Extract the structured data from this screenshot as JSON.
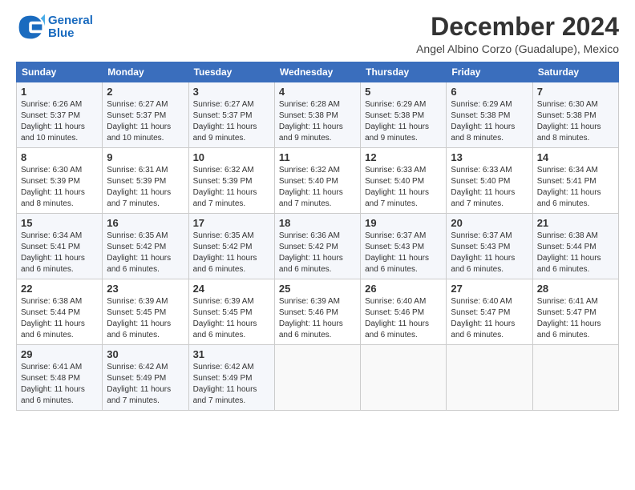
{
  "logo": {
    "line1": "General",
    "line2": "Blue"
  },
  "title": "December 2024",
  "subtitle": "Angel Albino Corzo (Guadalupe), Mexico",
  "days_of_week": [
    "Sunday",
    "Monday",
    "Tuesday",
    "Wednesday",
    "Thursday",
    "Friday",
    "Saturday"
  ],
  "weeks": [
    [
      {
        "day": 1,
        "sunrise": "6:26 AM",
        "sunset": "5:37 PM",
        "daylight": "11 hours and 10 minutes."
      },
      {
        "day": 2,
        "sunrise": "6:27 AM",
        "sunset": "5:37 PM",
        "daylight": "11 hours and 10 minutes."
      },
      {
        "day": 3,
        "sunrise": "6:27 AM",
        "sunset": "5:37 PM",
        "daylight": "11 hours and 9 minutes."
      },
      {
        "day": 4,
        "sunrise": "6:28 AM",
        "sunset": "5:38 PM",
        "daylight": "11 hours and 9 minutes."
      },
      {
        "day": 5,
        "sunrise": "6:29 AM",
        "sunset": "5:38 PM",
        "daylight": "11 hours and 9 minutes."
      },
      {
        "day": 6,
        "sunrise": "6:29 AM",
        "sunset": "5:38 PM",
        "daylight": "11 hours and 8 minutes."
      },
      {
        "day": 7,
        "sunrise": "6:30 AM",
        "sunset": "5:38 PM",
        "daylight": "11 hours and 8 minutes."
      }
    ],
    [
      {
        "day": 8,
        "sunrise": "6:30 AM",
        "sunset": "5:39 PM",
        "daylight": "11 hours and 8 minutes."
      },
      {
        "day": 9,
        "sunrise": "6:31 AM",
        "sunset": "5:39 PM",
        "daylight": "11 hours and 7 minutes."
      },
      {
        "day": 10,
        "sunrise": "6:32 AM",
        "sunset": "5:39 PM",
        "daylight": "11 hours and 7 minutes."
      },
      {
        "day": 11,
        "sunrise": "6:32 AM",
        "sunset": "5:40 PM",
        "daylight": "11 hours and 7 minutes."
      },
      {
        "day": 12,
        "sunrise": "6:33 AM",
        "sunset": "5:40 PM",
        "daylight": "11 hours and 7 minutes."
      },
      {
        "day": 13,
        "sunrise": "6:33 AM",
        "sunset": "5:40 PM",
        "daylight": "11 hours and 7 minutes."
      },
      {
        "day": 14,
        "sunrise": "6:34 AM",
        "sunset": "5:41 PM",
        "daylight": "11 hours and 6 minutes."
      }
    ],
    [
      {
        "day": 15,
        "sunrise": "6:34 AM",
        "sunset": "5:41 PM",
        "daylight": "11 hours and 6 minutes."
      },
      {
        "day": 16,
        "sunrise": "6:35 AM",
        "sunset": "5:42 PM",
        "daylight": "11 hours and 6 minutes."
      },
      {
        "day": 17,
        "sunrise": "6:35 AM",
        "sunset": "5:42 PM",
        "daylight": "11 hours and 6 minutes."
      },
      {
        "day": 18,
        "sunrise": "6:36 AM",
        "sunset": "5:42 PM",
        "daylight": "11 hours and 6 minutes."
      },
      {
        "day": 19,
        "sunrise": "6:37 AM",
        "sunset": "5:43 PM",
        "daylight": "11 hours and 6 minutes."
      },
      {
        "day": 20,
        "sunrise": "6:37 AM",
        "sunset": "5:43 PM",
        "daylight": "11 hours and 6 minutes."
      },
      {
        "day": 21,
        "sunrise": "6:38 AM",
        "sunset": "5:44 PM",
        "daylight": "11 hours and 6 minutes."
      }
    ],
    [
      {
        "day": 22,
        "sunrise": "6:38 AM",
        "sunset": "5:44 PM",
        "daylight": "11 hours and 6 minutes."
      },
      {
        "day": 23,
        "sunrise": "6:39 AM",
        "sunset": "5:45 PM",
        "daylight": "11 hours and 6 minutes."
      },
      {
        "day": 24,
        "sunrise": "6:39 AM",
        "sunset": "5:45 PM",
        "daylight": "11 hours and 6 minutes."
      },
      {
        "day": 25,
        "sunrise": "6:39 AM",
        "sunset": "5:46 PM",
        "daylight": "11 hours and 6 minutes."
      },
      {
        "day": 26,
        "sunrise": "6:40 AM",
        "sunset": "5:46 PM",
        "daylight": "11 hours and 6 minutes."
      },
      {
        "day": 27,
        "sunrise": "6:40 AM",
        "sunset": "5:47 PM",
        "daylight": "11 hours and 6 minutes."
      },
      {
        "day": 28,
        "sunrise": "6:41 AM",
        "sunset": "5:47 PM",
        "daylight": "11 hours and 6 minutes."
      }
    ],
    [
      {
        "day": 29,
        "sunrise": "6:41 AM",
        "sunset": "5:48 PM",
        "daylight": "11 hours and 6 minutes."
      },
      {
        "day": 30,
        "sunrise": "6:42 AM",
        "sunset": "5:49 PM",
        "daylight": "11 hours and 7 minutes."
      },
      {
        "day": 31,
        "sunrise": "6:42 AM",
        "sunset": "5:49 PM",
        "daylight": "11 hours and 7 minutes."
      },
      null,
      null,
      null,
      null
    ]
  ]
}
